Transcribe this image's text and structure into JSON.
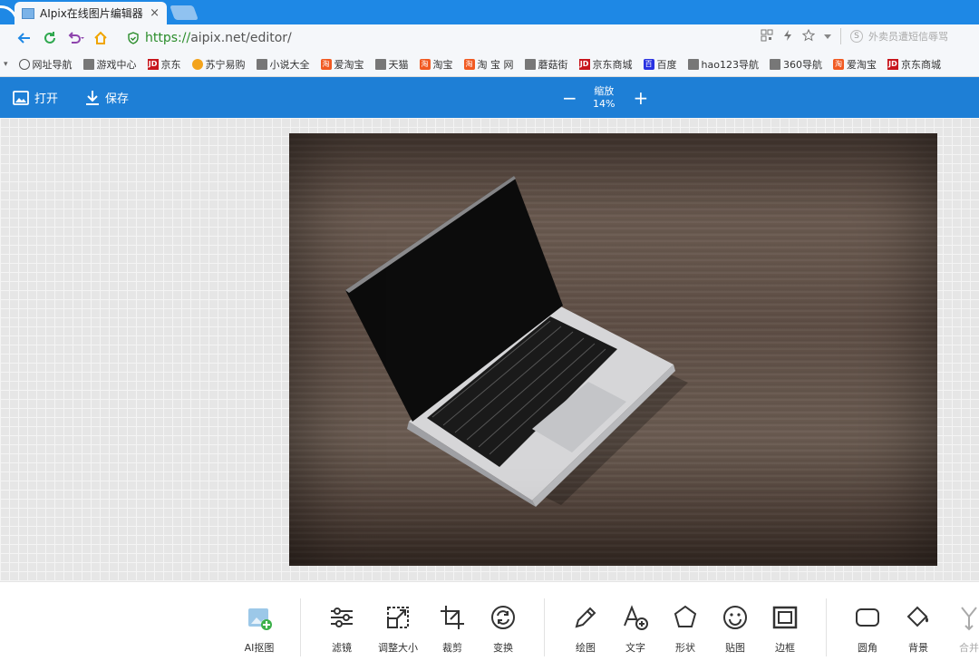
{
  "browser": {
    "tab_title": "AIpix在线图片编辑器",
    "tab_close": "×",
    "url_scheme": "https://",
    "url_rest": "aipix.net/editor/",
    "search_hint": "外卖员遭短信辱骂"
  },
  "bookmarks": [
    {
      "label": "网址导航",
      "icon": "globe"
    },
    {
      "label": "游戏中心",
      "icon": "doc"
    },
    {
      "label": "京东",
      "icon": "jd"
    },
    {
      "label": "苏宁易购",
      "icon": "suning"
    },
    {
      "label": "小说大全",
      "icon": "doc"
    },
    {
      "label": "爱淘宝",
      "icon": "tao"
    },
    {
      "label": "天猫",
      "icon": "doc"
    },
    {
      "label": "淘宝",
      "icon": "tao"
    },
    {
      "label": "淘 宝 网",
      "icon": "tao"
    },
    {
      "label": "蘑菇街",
      "icon": "doc"
    },
    {
      "label": "京东商城",
      "icon": "jd"
    },
    {
      "label": "百度",
      "icon": "baidu"
    },
    {
      "label": "hao123导航",
      "icon": "doc"
    },
    {
      "label": "360导航",
      "icon": "doc"
    },
    {
      "label": "爱淘宝",
      "icon": "tao"
    },
    {
      "label": "京东商城",
      "icon": "jd"
    }
  ],
  "toolbar": {
    "open_label": "打开",
    "save_label": "保存",
    "zoom_label": "缩放",
    "zoom_value": "14%",
    "zoom_out": "−",
    "zoom_in": "+"
  },
  "tools": [
    {
      "label": "AI抠图",
      "icon": "ai-cutout-icon",
      "enabled": true
    },
    {
      "label": "滤镜",
      "icon": "filter-sliders-icon",
      "enabled": true
    },
    {
      "label": "调整大小",
      "icon": "resize-icon",
      "enabled": true
    },
    {
      "label": "裁剪",
      "icon": "crop-icon",
      "enabled": true
    },
    {
      "label": "变换",
      "icon": "rotate-icon",
      "enabled": true
    },
    {
      "label": "绘图",
      "icon": "pencil-icon",
      "enabled": true
    },
    {
      "label": "文字",
      "icon": "text-add-icon",
      "enabled": true
    },
    {
      "label": "形状",
      "icon": "shape-icon",
      "enabled": true
    },
    {
      "label": "贴图",
      "icon": "sticker-smiley-icon",
      "enabled": true
    },
    {
      "label": "边框",
      "icon": "frame-icon",
      "enabled": true
    },
    {
      "label": "圆角",
      "icon": "rounded-corner-icon",
      "enabled": true
    },
    {
      "label": "背景",
      "icon": "paint-bucket-icon",
      "enabled": true
    },
    {
      "label": "合并",
      "icon": "merge-icon",
      "enabled": false
    }
  ],
  "colors": {
    "accent": "#1e7fd6",
    "browser_blue": "#1e88e5"
  }
}
